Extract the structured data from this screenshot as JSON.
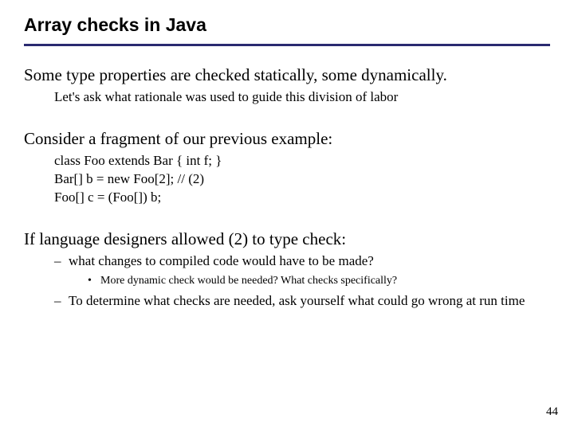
{
  "title": "Array checks in Java",
  "sec1": {
    "head": "Some type properties are checked statically, some dynamically.",
    "sub": "Let's ask what rationale was used to guide this division of labor"
  },
  "sec2": {
    "head": "Consider a fragment of our previous example:",
    "code1": "class Foo extends Bar { int f; }",
    "code2": "Bar[] b = new Foo[2];   // (2)",
    "code3": "Foo[] c = (Foo[]) b;"
  },
  "sec3": {
    "head": "If language designers allowed (2) to type check:",
    "b1": "what changes to compiled code would have to be made?",
    "b1sub": "More dynamic check would be needed?  What checks specifically?",
    "b2": "To determine what checks are needed, ask yourself what could go wrong at run time"
  },
  "pageNum": "44"
}
